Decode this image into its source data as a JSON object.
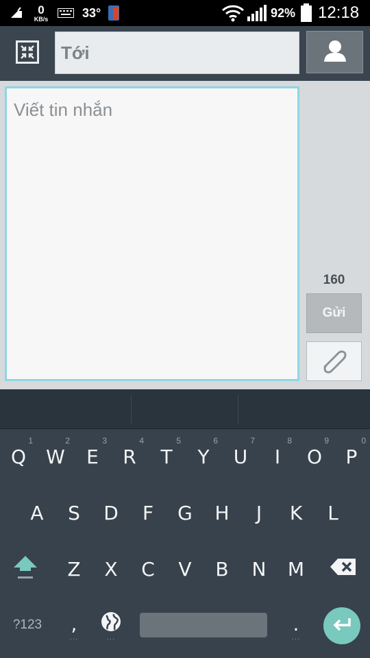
{
  "status_bar": {
    "network_speed_value": "0",
    "network_speed_unit": "KB/s",
    "temperature": "33°",
    "battery_percent": "92%",
    "time": "12:18"
  },
  "header": {
    "to_placeholder": "Tới"
  },
  "compose": {
    "message_placeholder": "Viết tin nhắn",
    "char_counter": "160",
    "send_label": "Gửi"
  },
  "keyboard": {
    "row1": [
      {
        "letter": "Q",
        "hint": "1"
      },
      {
        "letter": "W",
        "hint": "2"
      },
      {
        "letter": "E",
        "hint": "3"
      },
      {
        "letter": "R",
        "hint": "4"
      },
      {
        "letter": "T",
        "hint": "5"
      },
      {
        "letter": "Y",
        "hint": "6"
      },
      {
        "letter": "U",
        "hint": "7"
      },
      {
        "letter": "I",
        "hint": "8"
      },
      {
        "letter": "O",
        "hint": "9"
      },
      {
        "letter": "P",
        "hint": "0"
      }
    ],
    "row2": [
      "A",
      "S",
      "D",
      "F",
      "G",
      "H",
      "J",
      "K",
      "L"
    ],
    "row3": [
      "Z",
      "X",
      "C",
      "V",
      "B",
      "N",
      "M"
    ],
    "symbols_label": "?123",
    "comma": ",",
    "period": ".",
    "accent_color": "#79c9bf"
  },
  "icons": {
    "notification": "notification-icon",
    "keyboard": "keyboard-icon",
    "app": "app-icon",
    "wifi": "wifi-icon",
    "signal": "signal-icon",
    "battery": "battery-icon",
    "collapse": "collapse-icon",
    "contact": "contact-icon",
    "attach": "paperclip-icon",
    "shift": "shift-icon",
    "backspace": "backspace-icon",
    "globe": "globe-icon",
    "enter": "enter-icon"
  }
}
